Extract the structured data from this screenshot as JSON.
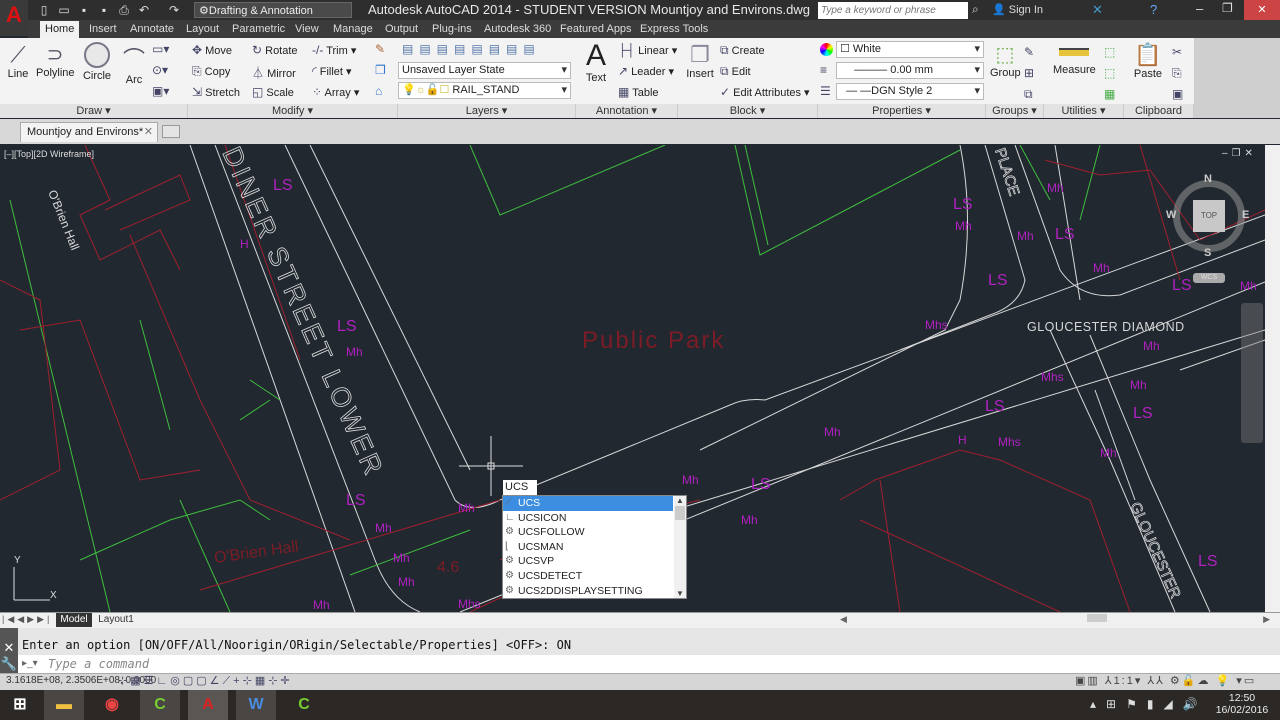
{
  "titlebar": {
    "workspace": "Drafting & Annotation",
    "title": "Autodesk AutoCAD 2014 - STUDENT VERSION    Mountjoy and Environs.dwg",
    "search_placeholder": "Type a keyword or phrase",
    "sign_in": "Sign In"
  },
  "ribbon_tabs": [
    "Home",
    "Insert",
    "Annotate",
    "Layout",
    "Parametric",
    "View",
    "Manage",
    "Output",
    "Plug-ins",
    "Autodesk 360",
    "Featured Apps",
    "Express Tools"
  ],
  "draw": {
    "label": "Draw ▾",
    "line": "Line",
    "polyline": "Polyline",
    "circle": "Circle",
    "arc": "Arc"
  },
  "modify": {
    "label": "Modify ▾",
    "move": "Move",
    "rotate": "Rotate",
    "trim": "Trim",
    "copy": "Copy",
    "mirror": "Mirror",
    "fillet": "Fillet",
    "stretch": "Stretch",
    "scale": "Scale",
    "array": "Array"
  },
  "layers": {
    "label": "Layers ▾",
    "layer_state": "Unsaved Layer State",
    "current_layer": "RAIL_STAND"
  },
  "annotation": {
    "label": "Annotation ▾",
    "text": "Text",
    "linear": "Linear",
    "leader": "Leader",
    "table": "Table"
  },
  "block": {
    "label": "Block ▾",
    "insert": "Insert",
    "create": "Create",
    "edit": "Edit",
    "edit_attributes": "Edit Attributes"
  },
  "properties": {
    "label": "Properties ▾",
    "color": "White",
    "lineweight": "0.00 mm",
    "linetype": "DGN Style 2"
  },
  "groups": {
    "label": "Groups ▾",
    "group": "Group"
  },
  "utilities": {
    "label": "Utilities ▾",
    "measure": "Measure"
  },
  "clipboard": {
    "label": "Clipboard",
    "paste": "Paste"
  },
  "file_tab": "Mountjoy and Environs*",
  "viewport": {
    "label": "[–][Top][2D Wireframe]",
    "viewcube": {
      "top": "TOP",
      "n": "N",
      "s": "S",
      "e": "E",
      "w": "W",
      "wcs": "WCS"
    }
  },
  "drawing_labels": {
    "obrien_hall": "O'Brien Hall",
    "obrien_hall_2": "O'Brien Hall",
    "street": "DINER STREET LOWER",
    "public_park": "Public Park",
    "gloucester_diamond": "GLOUCESTER DIAMOND",
    "place": "PLACE",
    "gloucester": "GLOUCESTER",
    "num": "4.6",
    "ls": "LS",
    "mh": "Mh",
    "mhs": "Mhs",
    "h": "H"
  },
  "autocomplete": {
    "input": "UCS",
    "items": [
      "UCS",
      "UCSICON",
      "UCSFOLLOW",
      "UCSMAN",
      "UCSVP",
      "UCSDETECT",
      "UCS2DDISPLAYSETTING"
    ],
    "selected": 0
  },
  "layout_tabs": [
    "Model",
    "Layout1"
  ],
  "command": {
    "history": "Enter an option [ON/OFF/All/Noorigin/ORigin/Selectable/Properties] <OFF>: ON",
    "placeholder": "Type a command"
  },
  "status": {
    "coords": "3.1618E+08, 2.3506E+08, 0.0000",
    "annotation_scale": "1:1"
  },
  "taskbar": {
    "time": "12:50",
    "date": "16/02/2016"
  }
}
